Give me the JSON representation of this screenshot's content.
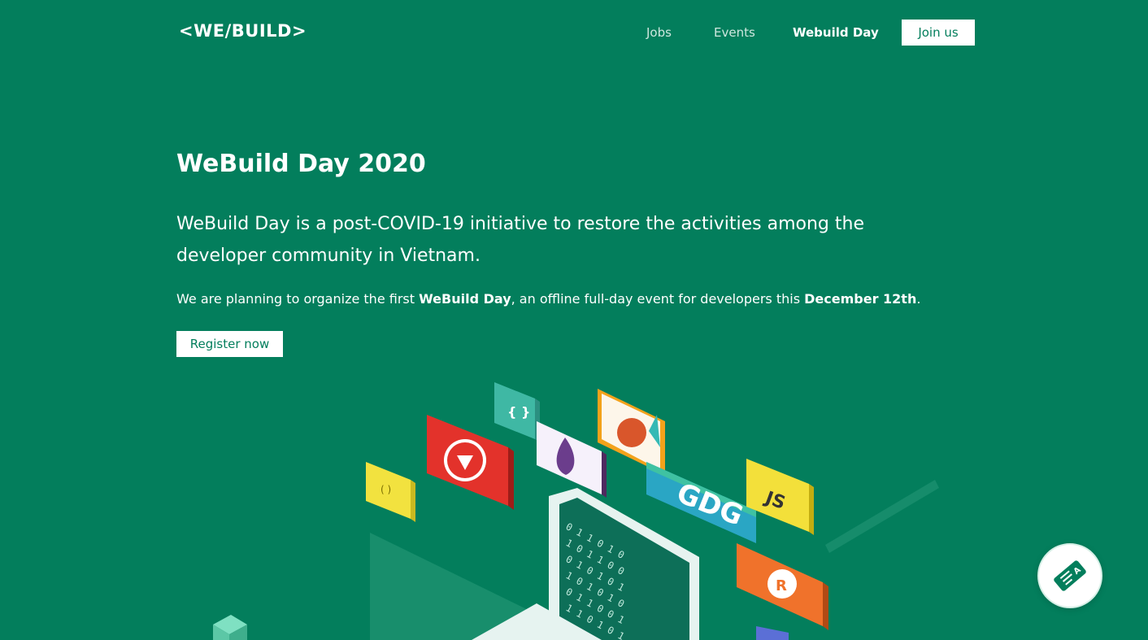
{
  "nav": {
    "logo": "<WE/BUILD>",
    "links": [
      {
        "label": "Jobs"
      },
      {
        "label": "Events"
      },
      {
        "label": "Webuild Day"
      }
    ],
    "join_label": "Join us"
  },
  "hero": {
    "title": "WeBuild Day 2020",
    "lead": "WeBuild Day is a post-COVID-19 initiative to restore the activities among the developer community in Vietnam.",
    "desc_prefix": "We are planning to organize the first ",
    "desc_event": "WeBuild Day",
    "desc_middle": ", an offline full-day event for developers this ",
    "desc_date": "December 12th",
    "desc_suffix": ".",
    "register_label": "Register now"
  },
  "illustration": {
    "cards": [
      {
        "label": "{ }",
        "icon": "braces-icon"
      },
      {
        "label": "( )",
        "icon": "parens-icon"
      },
      {
        "label": "",
        "icon": "ruby-icon"
      },
      {
        "label": "",
        "icon": "elixir-icon"
      },
      {
        "label": "",
        "icon": "mascot-icon"
      },
      {
        "label": "GDG",
        "icon": "gdg-icon"
      },
      {
        "label": "JS",
        "icon": "javascript-icon"
      },
      {
        "label": "R",
        "icon": "rust-icon"
      }
    ],
    "binary_rows": [
      "0 1 1 0 1 0",
      "1 0 1 1 0 0",
      "0 1 0 1 0 1",
      "1 0 1 0 1 0",
      "0 1 1 0 0 1",
      "1 1 0 1 0 1"
    ]
  },
  "fab": {
    "icon": "ticket-icon"
  },
  "colors": {
    "background": "#037e5c",
    "accent_text": "#037e5c"
  }
}
